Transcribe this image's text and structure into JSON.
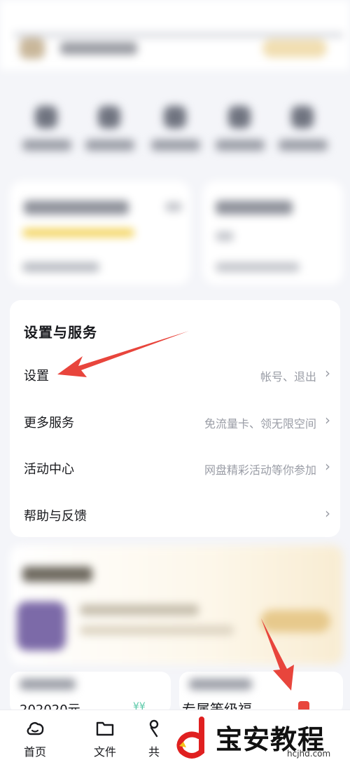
{
  "settings_services": {
    "title": "设置与服务",
    "rows": [
      {
        "label": "设置",
        "sub": "帐号、退出"
      },
      {
        "label": "更多服务",
        "sub": "免流量卡、领无限空间"
      },
      {
        "label": "活动中心",
        "sub": "网盘精彩活动等你参加"
      },
      {
        "label": "帮助与反馈",
        "sub": ""
      }
    ],
    "chevron": "›"
  },
  "bottom_partial": {
    "left_value": "202020元",
    "left_tag": "¥¥",
    "right_text": "专属等级福"
  },
  "tabbar": {
    "tabs": [
      {
        "label": "首页",
        "icon": "cloud-icon"
      },
      {
        "label": "文件",
        "icon": "folder-icon"
      },
      {
        "label": "共",
        "icon": "share-icon"
      }
    ]
  },
  "watermark": {
    "text": "宝安教程网",
    "url": "hcjhd.com"
  },
  "colors": {
    "background": "#f4f5f9",
    "arrow": "#e8453c",
    "secondary_text": "#9a9da6"
  }
}
